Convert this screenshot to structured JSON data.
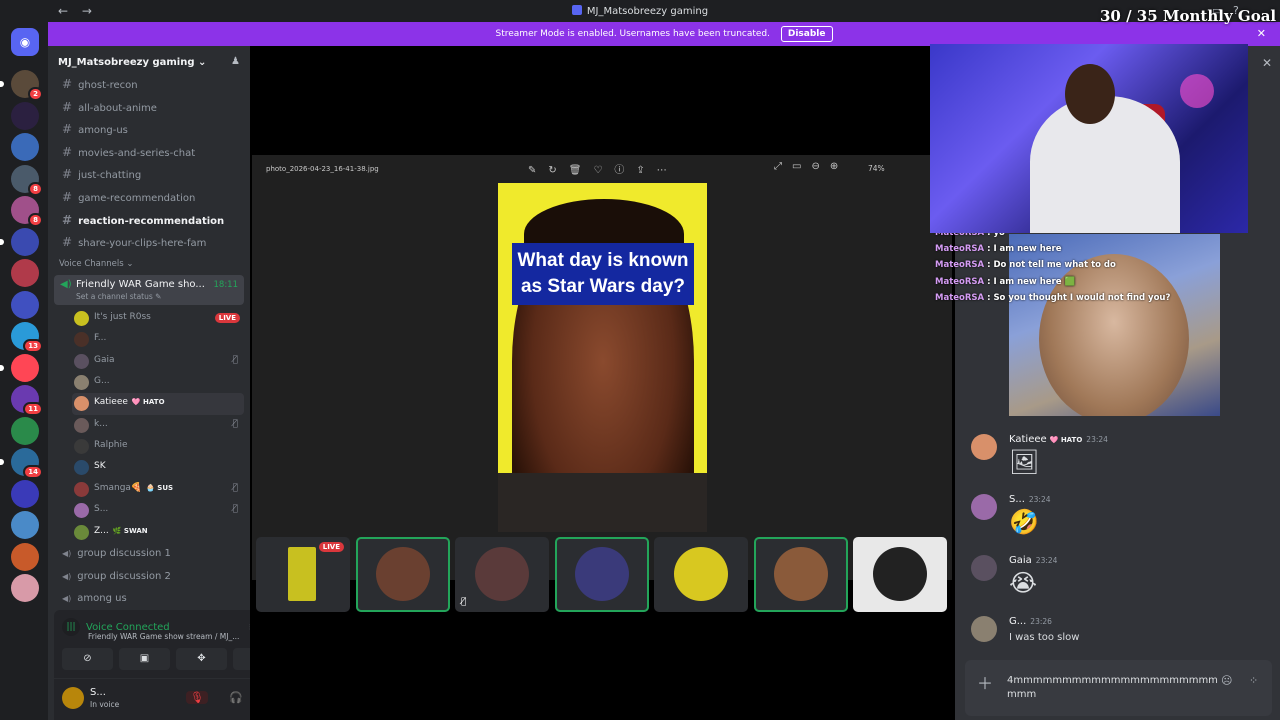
{
  "titlebar": {
    "back": "←",
    "forward": "→",
    "title": "MJ_Matsobreezy gaming"
  },
  "overlay_goal": "30 / 35 Monthly Goal",
  "banner": {
    "text": "Streamer Mode is enabled. Usernames have been truncated.",
    "button": "Disable"
  },
  "guilds": [
    {
      "badge": "2",
      "color": "#5a4a3a"
    },
    {
      "badge": "",
      "color": "#2b2040"
    },
    {
      "badge": "",
      "color": "#3a6ab8"
    },
    {
      "badge": "8",
      "color": "#4a5a6a"
    },
    {
      "badge": "8",
      "color": "#a0508a"
    },
    {
      "badge": "",
      "color": "#3a4ab0"
    },
    {
      "badge": "",
      "color": "#b03a4a"
    },
    {
      "badge": "",
      "color": "#4050c0"
    },
    {
      "badge": "13",
      "color": "#2a9ad8"
    },
    {
      "badge": "",
      "color": "#ff4655"
    },
    {
      "badge": "11",
      "color": "#6a3ab0"
    },
    {
      "badge": "",
      "color": "#2a8a4a"
    },
    {
      "badge": "14",
      "color": "#2a6a9a"
    },
    {
      "badge": "",
      "color": "#3a3ab8"
    },
    {
      "badge": "",
      "color": "#4a8ac8"
    },
    {
      "badge": "",
      "color": "#c85a2a"
    },
    {
      "badge": "",
      "color": "#d89aa8"
    }
  ],
  "server": {
    "name": "MJ_Matsobreezy gaming ⌄"
  },
  "text_channels": [
    {
      "name": "ghost-recon",
      "selected": false
    },
    {
      "name": "all-about-anime",
      "selected": false
    },
    {
      "name": "among-us",
      "selected": false
    },
    {
      "name": "movies-and-series-chat",
      "selected": false
    },
    {
      "name": "just-chatting",
      "selected": false
    },
    {
      "name": "game-recommendation",
      "selected": false
    },
    {
      "name": "reaction-recommendation",
      "selected": true
    },
    {
      "name": "share-your-clips-here-fam",
      "selected": false
    }
  ],
  "voice_category": "Voice Channels ⌄",
  "active_voice": {
    "name": "Friendly WAR Game sho...",
    "status": "Set a channel status ✎",
    "time": "18:11"
  },
  "voice_users": [
    {
      "name": "It's just R0ss",
      "live": "LIVE",
      "muted": false,
      "tag": "",
      "color": "#c8c020",
      "highlight": false
    },
    {
      "name": "F...",
      "live": "",
      "muted": false,
      "tag": "",
      "color": "#4a3028",
      "highlight": false
    },
    {
      "name": "Gaia",
      "live": "",
      "muted": true,
      "tag": "",
      "color": "#5a5060",
      "highlight": false
    },
    {
      "name": "G...",
      "live": "",
      "muted": false,
      "tag": "",
      "color": "#8a8070",
      "highlight": false
    },
    {
      "name": "Katieee",
      "live": "",
      "muted": false,
      "tag": "🩷 HATO",
      "color": "#d8906a",
      "highlight": true
    },
    {
      "name": "k...",
      "live": "",
      "muted": true,
      "tag": "",
      "color": "#6a5a5a",
      "highlight": false
    },
    {
      "name": "Ralphie",
      "live": "",
      "muted": false,
      "tag": "",
      "color": "#3a3a3a",
      "highlight": false
    },
    {
      "name": "SK",
      "live": "",
      "muted": false,
      "tag": "",
      "color": "#2a4a6a",
      "highlight": false
    },
    {
      "name": "Smanga🍕",
      "live": "",
      "muted": true,
      "tag": "🧁 SUS",
      "color": "#8a3a3a",
      "highlight": false
    },
    {
      "name": "S...",
      "live": "",
      "muted": true,
      "tag": "",
      "color": "#9a6aa8",
      "highlight": false
    },
    {
      "name": "Z...",
      "live": "",
      "muted": false,
      "tag": "🌿 SWAN",
      "color": "#6a8a3a",
      "highlight": false
    }
  ],
  "other_voice": [
    "group discussion 1",
    "group discussion 2",
    "among us"
  ],
  "voice_connected": {
    "status": "Voice Connected",
    "channel": "Friendly WAR Game show stream / MJ_..."
  },
  "user_panel": {
    "name": "S...",
    "status": "In voice"
  },
  "viewer": {
    "filename": "photo_2026-04-23_16-41-38.jpg",
    "zoom": "74%",
    "question": "What day is known as Star Wars day?"
  },
  "tiles": [
    {
      "label": "LIVE",
      "speaking": false,
      "muted": false,
      "color": "#c8c020"
    },
    {
      "label": "",
      "speaking": true,
      "muted": false,
      "color": "#6a4030"
    },
    {
      "label": "",
      "speaking": false,
      "muted": true,
      "color": "#5a3a3a"
    },
    {
      "label": "",
      "speaking": true,
      "muted": false,
      "color": "#3a3a7a"
    },
    {
      "label": "",
      "speaking": false,
      "muted": false,
      "color": "#d8c820"
    },
    {
      "label": "",
      "speaking": true,
      "muted": false,
      "color": "#8a5a3a"
    },
    {
      "label": "",
      "speaking": false,
      "muted": false,
      "color": "#e8e8e8"
    }
  ],
  "overlay_chat": [
    {
      "user": "MateoRSA",
      "text": "yo"
    },
    {
      "user": "MateoRSA",
      "text": "I am new here"
    },
    {
      "user": "MateoRSA",
      "text": "Do not tell me what to do"
    },
    {
      "user": "MateoRSA",
      "text": "I am new here 🟩"
    },
    {
      "user": "MateoRSA",
      "text": "So you thought I would not find you?"
    }
  ],
  "messages": [
    {
      "name": "Katieee",
      "hato": "🩷 HATO",
      "time": "23:24",
      "text": "",
      "emoji": "🖼",
      "color": "#d8906a"
    },
    {
      "name": "S...",
      "hato": "",
      "time": "23:24",
      "text": "",
      "emoji": "🤣",
      "color": "#9a6aa8"
    },
    {
      "name": "Gaia",
      "hato": "",
      "time": "23:24",
      "text": "",
      "emoji": "😭",
      "color": "#5a5060"
    },
    {
      "name": "G...",
      "hato": "",
      "time": "23:26",
      "text": "I was too slow",
      "emoji": "",
      "color": "#8a8070"
    }
  ],
  "composer": {
    "text": "4mmmmmmmmmmmmmmmmmmmmmmmm"
  }
}
